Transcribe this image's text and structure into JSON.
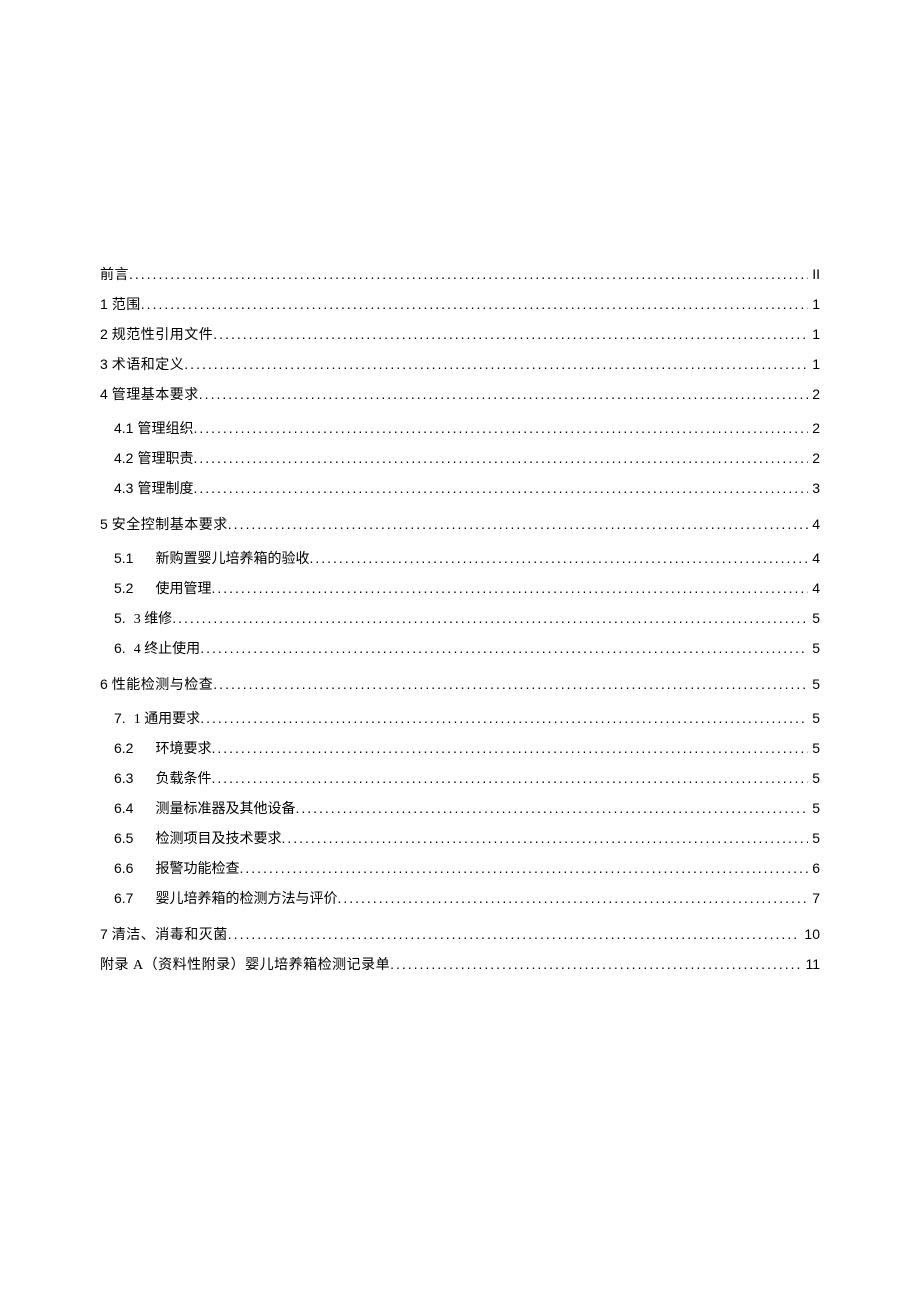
{
  "toc": [
    {
      "level": 1,
      "num": "",
      "label": "前言",
      "page": "II"
    },
    {
      "level": 1,
      "num": "1",
      "label": "范围",
      "page": "1"
    },
    {
      "level": 1,
      "num": "2",
      "label": "规范性引用文件",
      "page": "1"
    },
    {
      "level": 1,
      "num": "3",
      "label": "术语和定义",
      "page": "1"
    },
    {
      "level": 1,
      "num": "4",
      "label": "管理基本要求",
      "page": "2"
    },
    {
      "level": 2,
      "num": "4.1",
      "label": "管理组织",
      "page": "2"
    },
    {
      "level": 2,
      "num": "4.2",
      "label": "管理职责",
      "page": "2"
    },
    {
      "level": 2,
      "num": "4.3",
      "label": "管理制度",
      "page": "3"
    },
    {
      "level": 1,
      "num": "5",
      "label": "安全控制基本要求",
      "page": "4"
    },
    {
      "level": 2,
      "num": "5.1",
      "label": "新购置婴儿培养箱的验收",
      "page": "4"
    },
    {
      "level": 2,
      "num": "5.2",
      "label": "使用管理",
      "page": "4"
    },
    {
      "level": 2,
      "num": "5.",
      "label": "3 维修",
      "page": "5"
    },
    {
      "level": 2,
      "num": "6.",
      "label": "4 终止使用",
      "page": "5"
    },
    {
      "level": 1,
      "num": "6",
      "label": "性能检测与检查",
      "page": "5"
    },
    {
      "level": 2,
      "num": "7.",
      "label": "1 通用要求",
      "page": "5"
    },
    {
      "level": 2,
      "num": "6.2",
      "label": "环境要求",
      "page": "5"
    },
    {
      "level": 2,
      "num": "6.3",
      "label": "负载条件",
      "page": "5"
    },
    {
      "level": 2,
      "num": "6.4",
      "label": "测量标准器及其他设备",
      "page": "5"
    },
    {
      "level": 2,
      "num": "6.5",
      "label": "检测项目及技术要求 ",
      "page": "5"
    },
    {
      "level": 2,
      "num": "6.6",
      "label": "报警功能检查",
      "page": "6"
    },
    {
      "level": 2,
      "num": "6.7",
      "label": "婴儿培养箱的检测方法与评价",
      "page": "7"
    },
    {
      "level": 1,
      "num": "7",
      "label": "清洁、消毒和灭菌",
      "page": "10"
    },
    {
      "level": 1,
      "num": "",
      "label": "附录 A（资料性附录）婴儿培养箱检测记录单",
      "page": "11"
    }
  ]
}
